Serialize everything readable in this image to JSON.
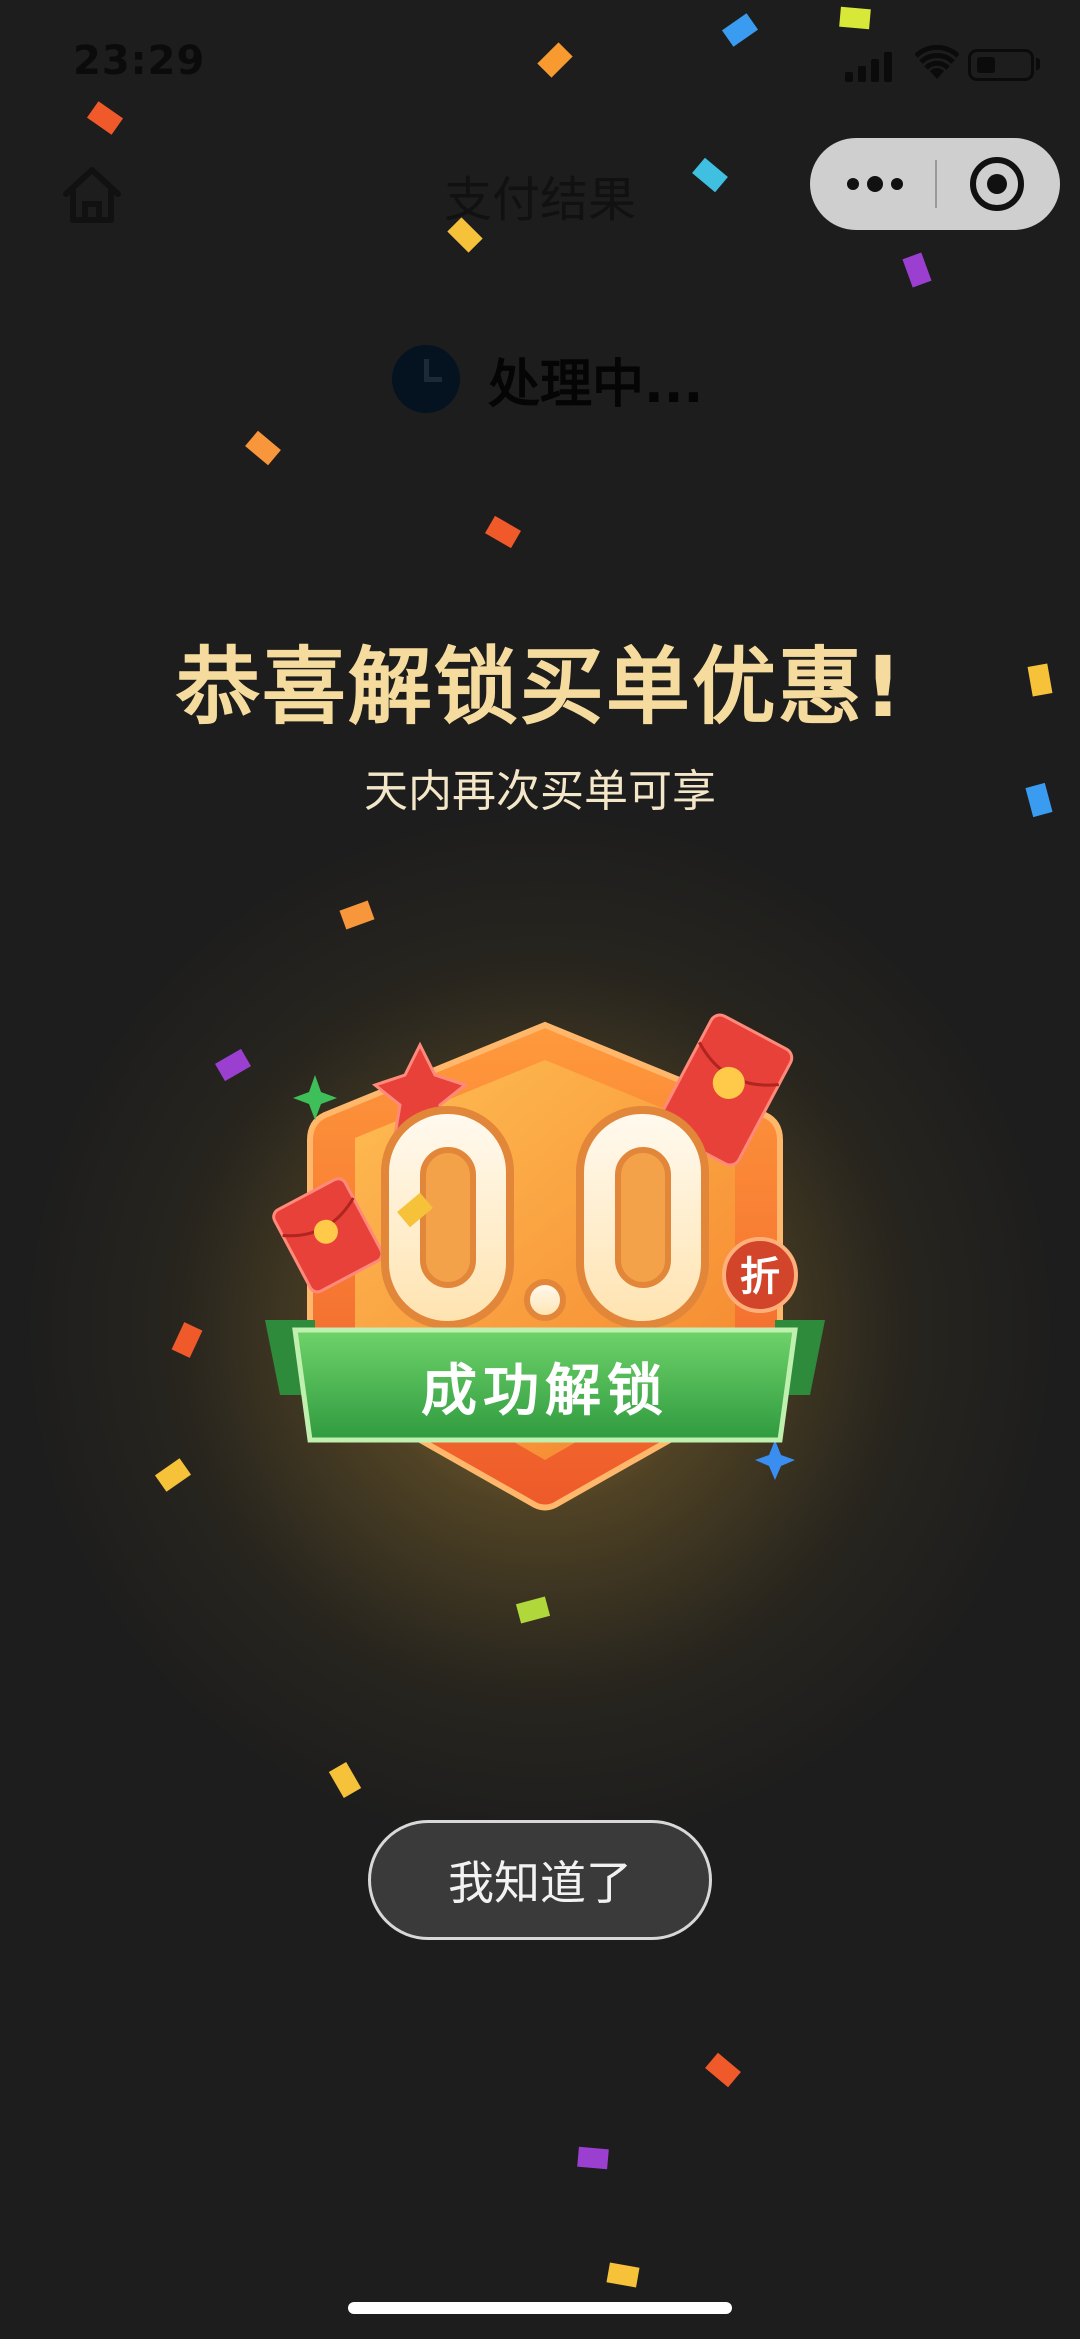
{
  "status_bar": {
    "time": "23:29"
  },
  "nav": {
    "title": "支付结果"
  },
  "processing": {
    "text": "处理中..."
  },
  "promo": {
    "headline": "恭喜解锁买单优惠!",
    "subline": "天内再次买单可享",
    "discount_value": "0.0",
    "discount_unit": "折",
    "ribbon_text": "成功解锁"
  },
  "actions": {
    "confirm_label": "我知道了"
  },
  "colors": {
    "background": "#1d1d1d",
    "headline": "#f5dc9e",
    "badge_orange": "#f26a2e",
    "ribbon_green": "#4caf50"
  },
  "icons": {
    "home": "home-icon",
    "more": "more-dots-icon",
    "close_miniprogram": "target-icon",
    "processing": "clock-icon"
  }
}
